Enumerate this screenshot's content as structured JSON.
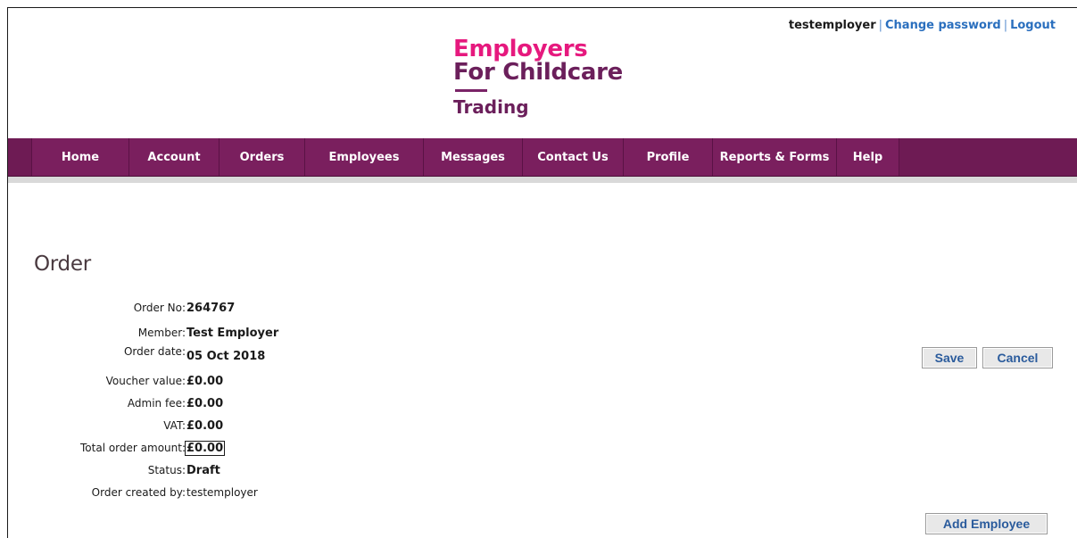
{
  "header": {
    "username": "testemployer",
    "separator": "|",
    "change_password": "Change password",
    "logout": "Logout",
    "logo": {
      "line1": "Employers",
      "line2": "For Childcare",
      "line3": "Trading"
    }
  },
  "nav": {
    "items": [
      "Home",
      "Account",
      "Orders",
      "Employees",
      "Messages",
      "Contact Us",
      "Profile",
      "Reports & Forms",
      "Help"
    ]
  },
  "page": {
    "title": "Order"
  },
  "order": {
    "order_no_label": "Order No:",
    "order_no": "264767",
    "member_label": "Member:",
    "member": "Test Employer",
    "date_label": "Order date:",
    "date": "05 Oct 2018",
    "voucher_label": "Voucher value:",
    "voucher": "£0.00",
    "admin_label": "Admin fee:",
    "admin": "£0.00",
    "vat_label": "VAT:",
    "vat": "£0.00",
    "total_label": "Total order amount:",
    "total": "£0.00",
    "status_label": "Status:",
    "status": "Draft",
    "created_label": "Order created by:",
    "created_by": "testemployer"
  },
  "actions": {
    "save": "Save",
    "cancel": "Cancel",
    "add_employee": "Add Employee"
  },
  "colors": {
    "brand_pink": "#e6197e",
    "brand_purple": "#6b1f5b",
    "nav_bg": "#7a1f5e",
    "link": "#2a6fbe"
  }
}
